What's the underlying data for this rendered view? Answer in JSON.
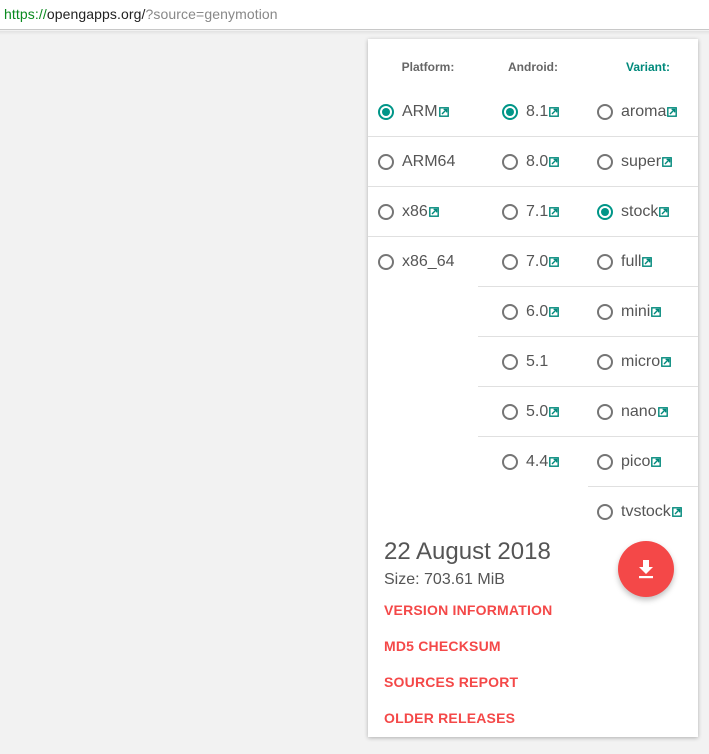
{
  "browser": {
    "url_protocol": "https://",
    "url_domain": "opengapps.org/",
    "url_path": "?source=genymotion"
  },
  "selector": {
    "headers": {
      "platform": "Platform:",
      "android": "Android:",
      "variant": "Variant:"
    },
    "platforms": [
      {
        "label": "ARM",
        "selected": true,
        "link": true
      },
      {
        "label": "ARM64",
        "selected": false,
        "link": false
      },
      {
        "label": "x86",
        "selected": false,
        "link": true
      },
      {
        "label": "x86_64",
        "selected": false,
        "link": false
      }
    ],
    "android_versions": [
      {
        "label": "8.1",
        "selected": true,
        "link": true
      },
      {
        "label": "8.0",
        "selected": false,
        "link": true
      },
      {
        "label": "7.1",
        "selected": false,
        "link": true
      },
      {
        "label": "7.0",
        "selected": false,
        "link": true
      },
      {
        "label": "6.0",
        "selected": false,
        "link": true
      },
      {
        "label": "5.1",
        "selected": false,
        "link": false
      },
      {
        "label": "5.0",
        "selected": false,
        "link": true
      },
      {
        "label": "4.4",
        "selected": false,
        "link": true
      }
    ],
    "variants": [
      {
        "label": "aroma",
        "selected": false,
        "link": true
      },
      {
        "label": "super",
        "selected": false,
        "link": true
      },
      {
        "label": "stock",
        "selected": true,
        "link": true
      },
      {
        "label": "full",
        "selected": false,
        "link": true
      },
      {
        "label": "mini",
        "selected": false,
        "link": true
      },
      {
        "label": "micro",
        "selected": false,
        "link": true
      },
      {
        "label": "nano",
        "selected": false,
        "link": true
      },
      {
        "label": "pico",
        "selected": false,
        "link": true
      },
      {
        "label": "tvstock",
        "selected": false,
        "link": true
      }
    ]
  },
  "release": {
    "date": "22 August 2018",
    "size": "Size: 703.61 MiB"
  },
  "links": {
    "version_information": "VERSION INFORMATION",
    "md5_checksum": "MD5 CHECKSUM",
    "sources_report": "SOURCES REPORT",
    "older_releases": "OLDER RELEASES"
  },
  "icons": {
    "external_link": "external-link-icon",
    "download": "download-icon"
  },
  "colors": {
    "accent_teal": "#009688",
    "accent_red": "#f44848",
    "url_green": "#0b8a1f"
  }
}
